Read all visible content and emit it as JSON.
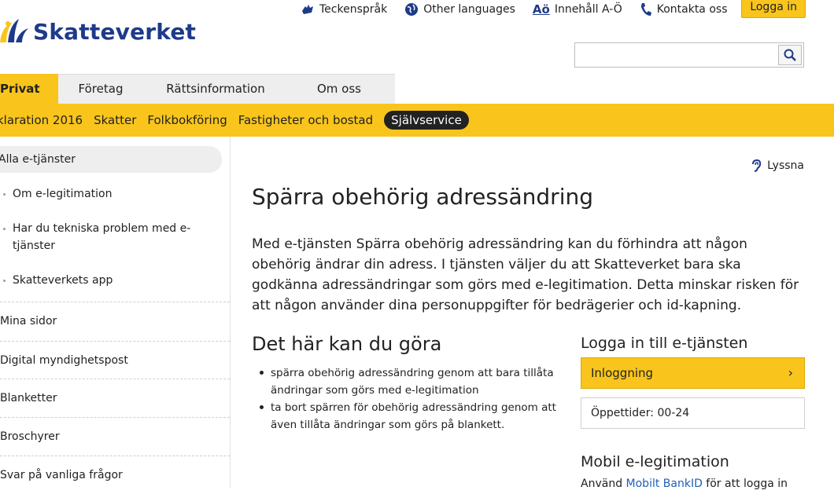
{
  "header": {
    "logo_text": "Skatteverket",
    "links": {
      "sign_language": "Teckenspråk",
      "other_languages": "Other languages",
      "ao_glyph": "Aö",
      "index": "Innehåll A-Ö",
      "contact": "Kontakta oss"
    },
    "login": "Logga in",
    "search": {
      "value": "",
      "placeholder": ""
    }
  },
  "tabs": [
    "Privat",
    "Företag",
    "Rättsinformation",
    "Om oss"
  ],
  "subnav": [
    "klaration 2016",
    "Skatter",
    "Folkbokföring",
    "Fastigheter och bostad",
    "Självservice"
  ],
  "sidebar": {
    "head": "Alla e-tjänster",
    "sub_items": [
      "Om e-legitimation",
      "Har du tekniska problem med e-tjänster",
      "Skatteverkets app"
    ],
    "items": [
      "Mina sidor",
      "Digital myndighetspost",
      "Blanketter",
      "Broschyrer",
      "Svar på vanliga frågor"
    ]
  },
  "content": {
    "listen": "Lyssna",
    "title": "Spärra obehörig adressändring",
    "intro": "Med e-tjänsten Spärra obehörig adressändring kan du förhindra att någon obehörig ändrar din adress. I tjänsten väljer du att Skatteverket bara ska godkänna adressändringar som görs med e-legitimation. Detta minskar risken för att någon använder dina personuppgifter för bedrägerier och id-kapning.",
    "section_title": "Det här kan du göra",
    "bullets": [
      "spärra obehörig adressändring genom att bara tillåta ändringar som görs med e-legitimation",
      "ta bort spärren för obehörig adressändring genom att även tillåta ändringar som görs på blankett."
    ]
  },
  "login_panel": {
    "title": "Logga in till e-tjänsten",
    "button": "Inloggning",
    "chevron": "›",
    "hours": "Öppettider: 00-24",
    "mobil_title": "Mobil e-legitimation",
    "mobil_text_before": "Använd ",
    "mobil_link": "Mobilt BankID",
    "mobil_text_after": " för att logga in"
  },
  "colors": {
    "brand_yellow": "#f9c51c",
    "brand_blue": "#1e3a8a",
    "link_blue": "#1e5fb8"
  }
}
